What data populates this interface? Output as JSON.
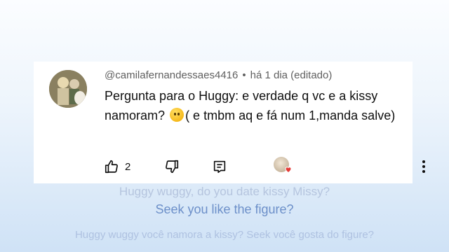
{
  "comment": {
    "username": "@camilafernandessaes4416",
    "separator": "•",
    "time": "há 1 dia (editado)",
    "text_part1": "Pergunta para o Huggy: e verdade q vc e a kissy namoram?",
    "text_part2": "( e tmbm aq e fá num 1,manda salve)",
    "emoji": "thinking-face",
    "like_count": "2"
  },
  "subtitles": {
    "line1": "Huggy wuggy, do you date kissy Missy?",
    "line2": "Seek you like the figure?",
    "line3": "Huggy wuggy você namora a kissy?  Seek você gosta do figure?"
  },
  "colors": {
    "accent_heart": "#e53935",
    "subtitle_blue": "#6c8fc9"
  }
}
